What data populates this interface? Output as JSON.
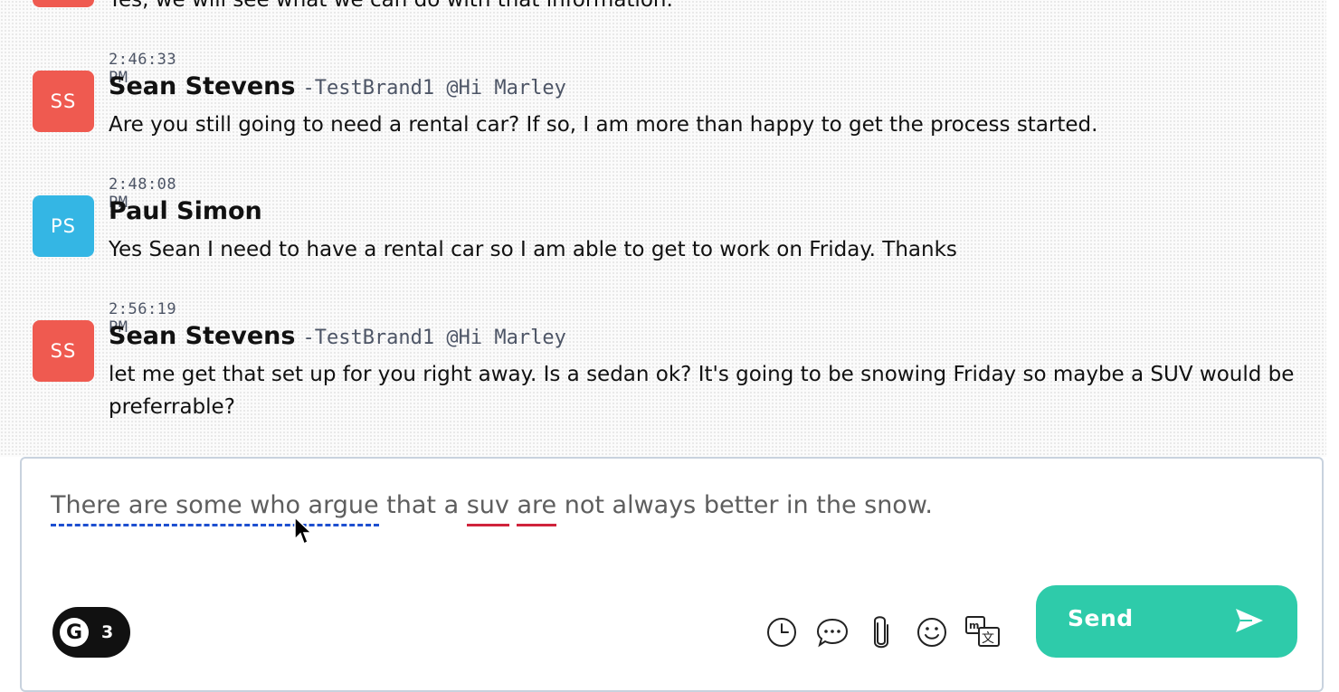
{
  "messages": [
    {
      "text": "Yes, we will see what we can do with that information.",
      "avatar_color": "#ef5a50"
    },
    {
      "timestamp": "2:46:33 PM",
      "initials": "SS",
      "avatar_color": "#ef5a50",
      "sender": "Sean Stevens",
      "brand": "-TestBrand1 @Hi Marley",
      "text": "Are you still going to need a rental car? If so, I am more than happy to get the process started."
    },
    {
      "timestamp": "2:48:08 PM",
      "initials": "PS",
      "avatar_color": "#34b6e4",
      "sender": "Paul Simon",
      "text": "Yes Sean I need to have a rental car so I am able to get to work on Friday. Thanks"
    },
    {
      "timestamp": "2:56:19 PM",
      "initials": "SS",
      "avatar_color": "#ef5a50",
      "sender": "Sean Stevens",
      "brand": "-TestBrand1 @Hi Marley",
      "text": "let me get that set up for you right away. Is a sedan ok? It's going to be snowing Friday so maybe a SUV would be preferrable?"
    }
  ],
  "composer": {
    "draft_part1": "There are some who argue",
    "draft_part2": " that a ",
    "draft_part3": "suv",
    "draft_part4": " ",
    "draft_part5": "are",
    "draft_part6": " not always better in the snow.",
    "grammarly_logo": "G",
    "grammarly_count": "3",
    "tools": [
      "clock-icon",
      "chat-bubble-icon",
      "paperclip-icon",
      "emoji-icon",
      "translate-icon"
    ],
    "send_label": "Send"
  },
  "colors": {
    "send_button": "#2ecbaa",
    "suggestion_underline": "#1d4fd0",
    "error_underline": "#d0243c"
  }
}
